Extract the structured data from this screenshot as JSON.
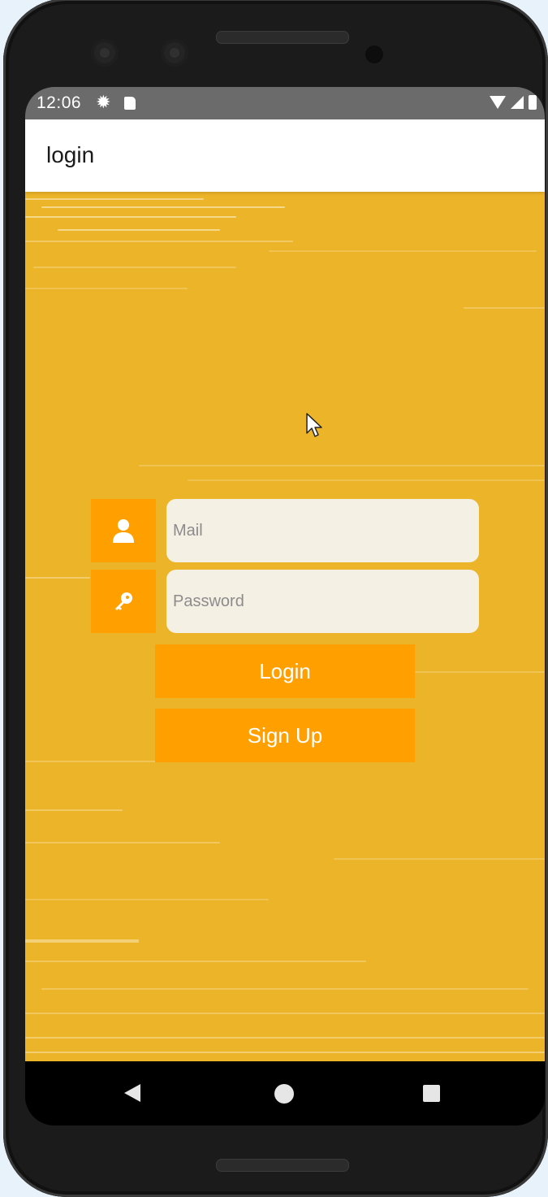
{
  "status_bar": {
    "time": "12:06",
    "icons": [
      "gear-icon",
      "sd-card-icon",
      "wifi-icon",
      "signal-icon",
      "battery-icon"
    ]
  },
  "app_bar": {
    "title": "login"
  },
  "form": {
    "mail": {
      "placeholder": "Mail",
      "value": "",
      "icon": "person-icon"
    },
    "password": {
      "placeholder": "Password",
      "value": "",
      "icon": "key-icon"
    },
    "login_label": "Login",
    "signup_label": "Sign Up"
  },
  "nav_bar": {
    "icons": [
      "back-icon",
      "home-icon",
      "recents-icon"
    ]
  },
  "colors": {
    "background": "#ecb428",
    "accent": "#ffa000",
    "input_fill": "#f5f0e4",
    "app_bar": "#ffffff",
    "status_bar": "#6b6b6b"
  }
}
